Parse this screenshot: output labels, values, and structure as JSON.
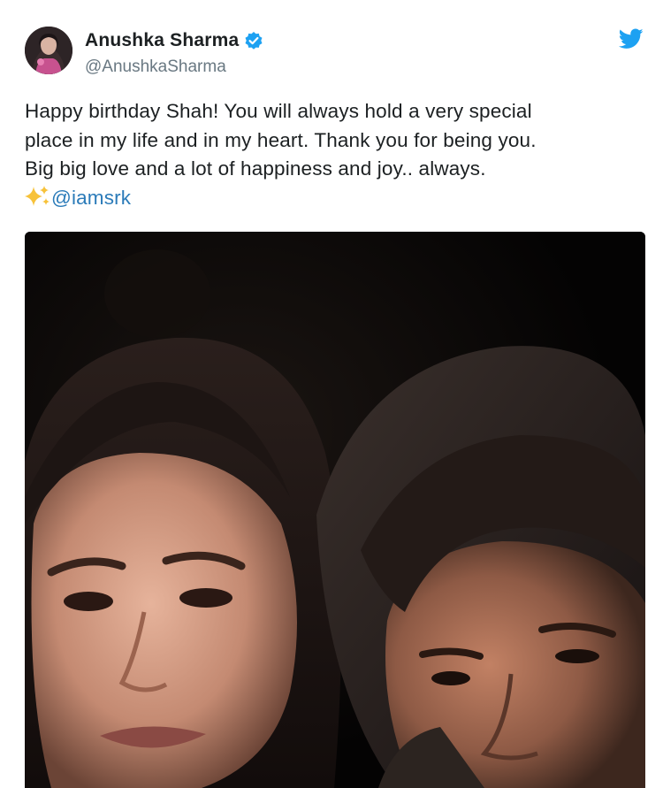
{
  "author": {
    "display_name": "Anushka Sharma",
    "handle": "@AnushkaSharma",
    "verified": true
  },
  "icons": {
    "avatar": "profile-photo",
    "verified": "verified-badge-icon",
    "brand": "twitter-bird-icon",
    "emoji": "sparkles-emoji"
  },
  "tweet": {
    "line_1": "Happy birthday Shah! You will always hold a very special",
    "line_2": "place in my life and in my heart. Thank you for being you.",
    "line_3": "Big big love and a lot of happiness and joy.. always.",
    "mention": "@iamsrk"
  },
  "colors": {
    "brand_blue": "#1da1f2",
    "mention_blue": "#2b7bb9",
    "handle_gray": "#697882",
    "text": "#1c2022"
  }
}
